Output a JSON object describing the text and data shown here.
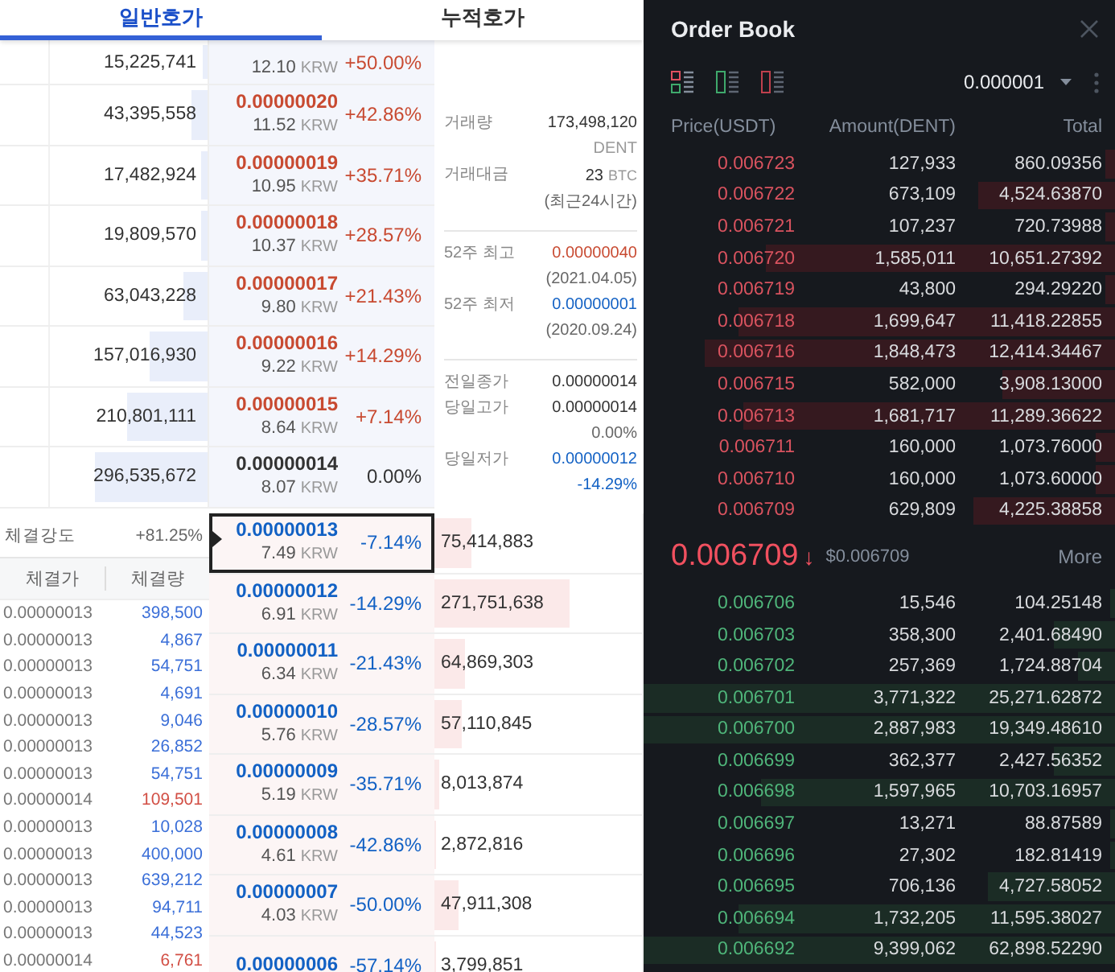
{
  "left_panel": {
    "tabs": [
      {
        "label": "일반호가",
        "selected": true
      },
      {
        "label": "누적호가",
        "selected": false
      }
    ],
    "asks": [
      {
        "volume": "15,225,741",
        "level": 0.03,
        "krw": "12.10",
        "unit": "KRW",
        "change": "+50.00%",
        "color": "#c84a31"
      },
      {
        "volume": "43,395,558",
        "level": 0.1,
        "price": "0.00000020",
        "krw": "11.52",
        "unit": "KRW",
        "change": "+42.86%",
        "color": "#c84a31"
      },
      {
        "volume": "17,482,924",
        "level": 0.04,
        "price": "0.00000019",
        "krw": "10.95",
        "unit": "KRW",
        "change": "+35.71%",
        "color": "#c84a31"
      },
      {
        "volume": "19,809,570",
        "level": 0.04,
        "price": "0.00000018",
        "krw": "10.37",
        "unit": "KRW",
        "change": "+28.57%",
        "color": "#c84a31"
      },
      {
        "volume": "63,043,228",
        "level": 0.15,
        "price": "0.00000017",
        "krw": "9.80",
        "unit": "KRW",
        "change": "+21.43%",
        "color": "#c84a31"
      },
      {
        "volume": "157,016,930",
        "level": 0.37,
        "price": "0.00000016",
        "krw": "9.22",
        "unit": "KRW",
        "change": "+14.29%",
        "color": "#c84a31"
      },
      {
        "volume": "210,801,111",
        "level": 0.51,
        "price": "0.00000015",
        "krw": "8.64",
        "unit": "KRW",
        "change": "+7.14%",
        "color": "#c84a31"
      },
      {
        "volume": "296,535,672",
        "level": 0.71,
        "price": "0.00000014",
        "krw": "8.07",
        "unit": "KRW",
        "change": "0.00%",
        "color": "#333333"
      }
    ],
    "market_info": [
      {
        "rows": [
          {
            "label": "거래량",
            "value": "173,498,120",
            "color": "#333333",
            "note": {
              "text": "DENT",
              "color": "#999999"
            }
          },
          {
            "label": "거래대금",
            "value": "23",
            "unit": "BTC",
            "color": "#333333",
            "note": {
              "text": "(최근24시간)",
              "color": "#666666"
            }
          }
        ]
      },
      {
        "rows": [
          {
            "label": "52주 최고",
            "value": "0.00000040",
            "color": "#c84a31",
            "note": {
              "text": "(2021.04.05)",
              "color": "#666666"
            }
          },
          {
            "label": "52주 최저",
            "value": "0.00000001",
            "color": "#1261c4",
            "note": {
              "text": "(2020.09.24)",
              "color": "#666666"
            }
          }
        ]
      },
      {
        "rows": [
          {
            "label": "전일종가",
            "value": "0.00000014",
            "color": "#333333"
          },
          {
            "label": "당일고가",
            "value": "0.00000014",
            "color": "#333333",
            "note": {
              "text": "0.00%",
              "color": "#666666"
            }
          },
          {
            "label": "당일저가",
            "value": "0.00000012",
            "color": "#1261c4",
            "note": {
              "text": "-14.29%",
              "color": "#1261c4"
            }
          }
        ]
      }
    ],
    "trade_strength": {
      "label": "체결강도",
      "value": "+81.25%"
    },
    "trades": {
      "columns": [
        "체결가",
        "체결량"
      ],
      "rows": [
        {
          "price": "0.00000013",
          "amount": "398,500",
          "color": "#3b6fd8"
        },
        {
          "price": "0.00000013",
          "amount": "4,867",
          "color": "#3b6fd8"
        },
        {
          "price": "0.00000013",
          "amount": "54,751",
          "color": "#3b6fd8"
        },
        {
          "price": "0.00000013",
          "amount": "4,691",
          "color": "#3b6fd8"
        },
        {
          "price": "0.00000013",
          "amount": "9,046",
          "color": "#3b6fd8"
        },
        {
          "price": "0.00000013",
          "amount": "26,852",
          "color": "#3b6fd8"
        },
        {
          "price": "0.00000013",
          "amount": "54,751",
          "color": "#3b6fd8"
        },
        {
          "price": "0.00000014",
          "amount": "109,501",
          "color": "#d24f45"
        },
        {
          "price": "0.00000013",
          "amount": "10,028",
          "color": "#3b6fd8"
        },
        {
          "price": "0.00000013",
          "amount": "400,000",
          "color": "#3b6fd8"
        },
        {
          "price": "0.00000013",
          "amount": "639,212",
          "color": "#3b6fd8"
        },
        {
          "price": "0.00000013",
          "amount": "94,711",
          "color": "#3b6fd8"
        },
        {
          "price": "0.00000013",
          "amount": "44,523",
          "color": "#3b6fd8"
        },
        {
          "price": "0.00000014",
          "amount": "6,761",
          "color": "#d24f45"
        }
      ]
    },
    "bids": [
      {
        "price": "0.00000013",
        "krw": "7.49",
        "unit": "KRW",
        "change": "-7.14%",
        "color": "#1261c4",
        "volume": "75,414,883",
        "level": 0.18,
        "selected": true
      },
      {
        "price": "0.00000012",
        "krw": "6.91",
        "unit": "KRW",
        "change": "-14.29%",
        "color": "#1261c4",
        "volume": "271,751,638",
        "level": 0.65,
        "selected": false
      },
      {
        "price": "0.00000011",
        "krw": "6.34",
        "unit": "KRW",
        "change": "-21.43%",
        "color": "#1261c4",
        "volume": "64,869,303",
        "level": 0.15,
        "selected": false
      },
      {
        "price": "0.00000010",
        "krw": "5.76",
        "unit": "KRW",
        "change": "-28.57%",
        "color": "#1261c4",
        "volume": "57,110,845",
        "level": 0.13,
        "selected": false
      },
      {
        "price": "0.00000009",
        "krw": "5.19",
        "unit": "KRW",
        "change": "-35.71%",
        "color": "#1261c4",
        "volume": "8,013,874",
        "level": 0.02,
        "selected": false
      },
      {
        "price": "0.00000008",
        "krw": "4.61",
        "unit": "KRW",
        "change": "-42.86%",
        "color": "#1261c4",
        "volume": "2,872,816",
        "level": 0.01,
        "selected": false
      },
      {
        "price": "0.00000007",
        "krw": "4.03",
        "unit": "KRW",
        "change": "-50.00%",
        "color": "#1261c4",
        "volume": "47,911,308",
        "level": 0.12,
        "selected": false
      },
      {
        "price": "0.00000006",
        "change": "-57.14%",
        "color": "#1261c4",
        "volume": "3,799,851",
        "level": 0.01,
        "selected": false
      }
    ]
  },
  "order_book": {
    "title": "Order Book",
    "tick_size": "0.000001",
    "columns": [
      "Price(USDT)",
      "Amount(DENT)",
      "Total"
    ],
    "asks": [
      {
        "price": "0.006723",
        "amount": "127,933",
        "total": "860.09356",
        "level": 0.02
      },
      {
        "price": "0.006722",
        "amount": "673,109",
        "total": "4,524.63870",
        "level": 0.29
      },
      {
        "price": "0.006721",
        "amount": "107,237",
        "total": "720.73988",
        "level": 0.02
      },
      {
        "price": "0.006720",
        "amount": "1,585,011",
        "total": "10,651.27392",
        "level": 0.74
      },
      {
        "price": "0.006719",
        "amount": "43,800",
        "total": "294.29220",
        "level": 0.02
      },
      {
        "price": "0.006718",
        "amount": "1,699,647",
        "total": "11,418.22855",
        "level": 0.8
      },
      {
        "price": "0.006716",
        "amount": "1,848,473",
        "total": "12,414.34467",
        "level": 0.87
      },
      {
        "price": "0.006715",
        "amount": "582,000",
        "total": "3,908.13000",
        "level": 0.24
      },
      {
        "price": "0.006713",
        "amount": "1,681,717",
        "total": "11,289.36622",
        "level": 0.79
      },
      {
        "price": "0.006711",
        "amount": "160,000",
        "total": "1,073.76000",
        "level": 0.04
      },
      {
        "price": "0.006710",
        "amount": "160,000",
        "total": "1,073.60000",
        "level": 0.04
      },
      {
        "price": "0.006709",
        "amount": "629,809",
        "total": "4,225.38858",
        "level": 0.3
      }
    ],
    "last_price": {
      "price": "0.006709",
      "arrow": "↓",
      "usd": "$0.006709"
    },
    "more": "More",
    "bids": [
      {
        "price": "0.006706",
        "amount": "15,546",
        "total": "104.25148",
        "level": 0.01
      },
      {
        "price": "0.006703",
        "amount": "358,300",
        "total": "2,401.68490",
        "level": 0.13
      },
      {
        "price": "0.006702",
        "amount": "257,369",
        "total": "1,724.88704",
        "level": 0.08
      },
      {
        "price": "0.006701",
        "amount": "3,771,322",
        "total": "25,271.62872",
        "level": 1
      },
      {
        "price": "0.006700",
        "amount": "2,887,983",
        "total": "19,349.48610",
        "level": 1
      },
      {
        "price": "0.006699",
        "amount": "362,377",
        "total": "2,427.56352",
        "level": 0.13
      },
      {
        "price": "0.006698",
        "amount": "1,597,965",
        "total": "10,703.16957",
        "level": 0.75
      },
      {
        "price": "0.006697",
        "amount": "13,271",
        "total": "88.87589",
        "level": 0.01
      },
      {
        "price": "0.006696",
        "amount": "27,302",
        "total": "182.81419",
        "level": 0.01
      },
      {
        "price": "0.006695",
        "amount": "706,136",
        "total": "4,727.58052",
        "level": 0.27
      },
      {
        "price": "0.006694",
        "amount": "1,732,205",
        "total": "11,595.38027",
        "level": 0.8
      },
      {
        "price": "0.006692",
        "amount": "9,399,062",
        "total": "62,898.52290",
        "level": 1
      }
    ]
  }
}
